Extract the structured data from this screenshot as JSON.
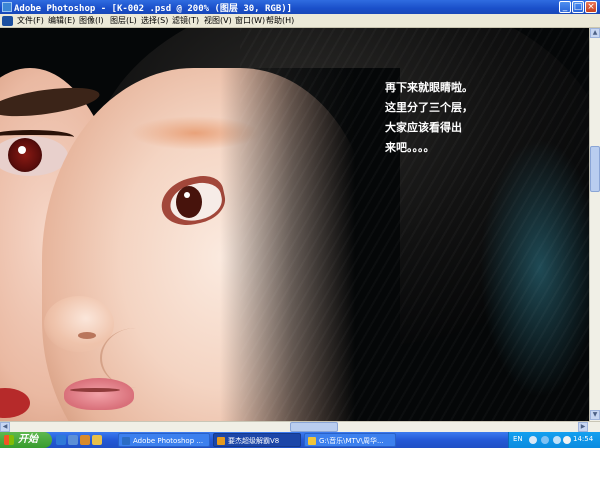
{
  "window": {
    "title": "Adobe Photoshop - [K-002 .psd @ 200% (图层 30, RGB)]",
    "min_btn": "_",
    "max_btn": "□",
    "close_btn": "×"
  },
  "menu": {
    "items": [
      "文件(F)",
      "编辑(E)",
      "图像(I)",
      "图层(L)",
      "选择(S)",
      "滤镜(T)",
      "视图(V)",
      "窗口(W)",
      "帮助(H)"
    ]
  },
  "canvas": {
    "note_lines": [
      "再下来就眼睛啦。",
      "这里分了三个层，",
      "大家应该看得出",
      "来吧。。。。"
    ]
  },
  "scrollbars": {
    "up": "▲",
    "down": "▼",
    "left": "◀",
    "right": "▶"
  },
  "taskbar": {
    "start_label": "开始",
    "tasks": [
      {
        "label": "Adobe Photoshop ...",
        "icon_color": "#2b6cc4",
        "active": false
      },
      {
        "label": "要杰超级解霸V8",
        "icon_color": "#e59a1f",
        "active": true
      },
      {
        "label": "G:\\音乐\\MTV\\周华...",
        "icon_color": "#f0c53a",
        "active": false
      }
    ],
    "tray": {
      "lang": "EN",
      "time": "14:54"
    }
  },
  "colors": {
    "title_bar": "#1a4fc9",
    "taskbar": "#2459d6",
    "start_button": "#379b2e",
    "tray": "#0c8be0"
  }
}
